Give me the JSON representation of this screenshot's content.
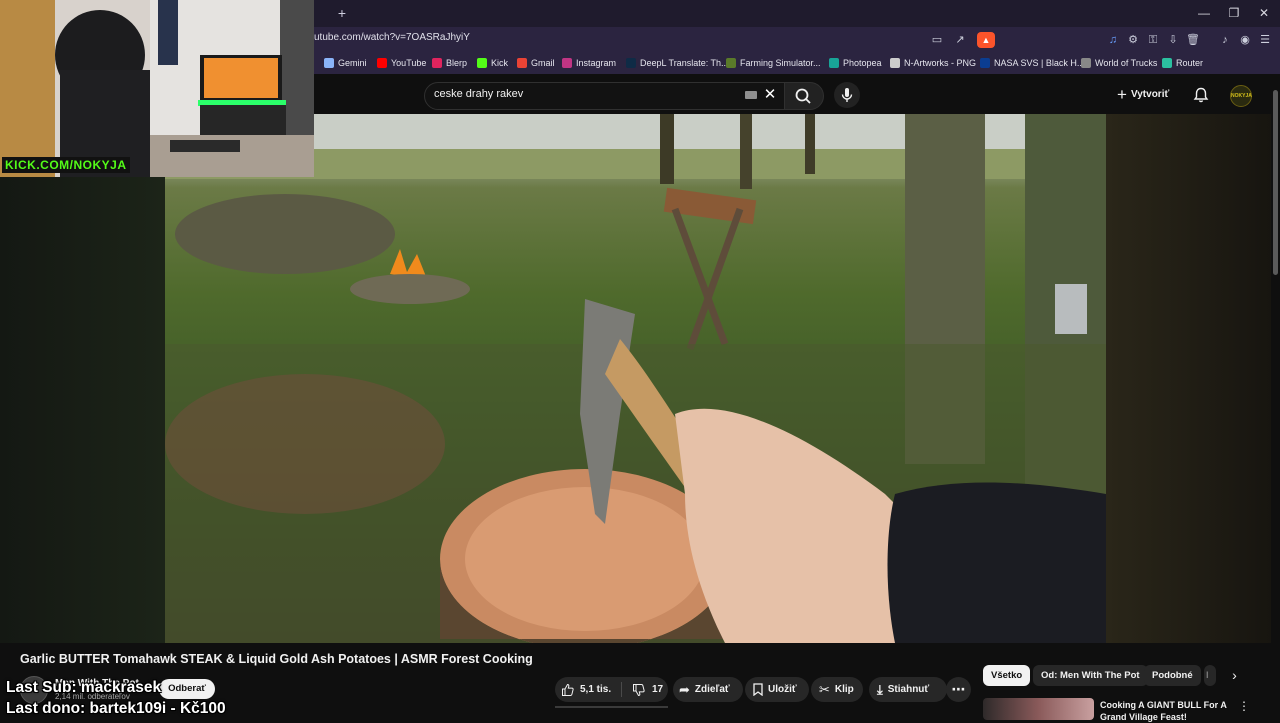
{
  "browser": {
    "url": "utube.com/watch?v=7OASRaJhyiY",
    "new_tab": "+",
    "window_controls": [
      "minimize-icon",
      "restore-icon",
      "close-icon"
    ],
    "bookmarks": [
      {
        "label": "Gemini",
        "icon": "gemini-icon",
        "color": "#8ab4f8"
      },
      {
        "label": "YouTube",
        "icon": "youtube-icon",
        "color": "#ff0000"
      },
      {
        "label": "Blerp",
        "icon": "blerp-icon",
        "color": "#e0245e"
      },
      {
        "label": "Kick",
        "icon": "kick-icon",
        "color": "#53fc18"
      },
      {
        "label": "Gmail",
        "icon": "gmail-icon",
        "color": "#ea4335"
      },
      {
        "label": "Instagram",
        "icon": "instagram-icon",
        "color": "#c13584"
      },
      {
        "label": "DeepL Translate: Th...",
        "icon": "deepl-icon",
        "color": "#0f2b46"
      },
      {
        "label": "Farming Simulator...",
        "icon": "farming-icon",
        "color": "#5a7a2a"
      },
      {
        "label": "Photopea",
        "icon": "photopea-icon",
        "color": "#18a497"
      },
      {
        "label": "N-Artworks - PNG",
        "icon": "nartworks-icon",
        "color": "#cccccc"
      },
      {
        "label": "NASA SVS | Black H...",
        "icon": "nasa-icon",
        "color": "#0b3d91"
      },
      {
        "label": "World of Trucks",
        "icon": "wot-icon",
        "color": "#888888"
      },
      {
        "label": "Router",
        "icon": "router-icon",
        "color": "#2bc0a0"
      }
    ]
  },
  "youtube": {
    "search_value": "ceske drahy rakev",
    "create_label": "Vytvoriť",
    "avatar_text": "NOKYJA",
    "video_title": "Garlic BUTTER Tomahawk STEAK & Liquid Gold Ash Potatoes | ASMR Forest Cooking",
    "channel_name": "Men With The Pot",
    "channel_subs": "2,14 mil. odberateľov",
    "subscribe_label": "Odberať",
    "likes": "5,1 tis.",
    "dislikes": "17",
    "share_label": "Zdieľať",
    "save_label": "Uložiť",
    "clip_label": "Klip",
    "download_label": "Stiahnuť",
    "chips": [
      "Všetko",
      "Od: Men With The Pot",
      "Podobné",
      "I"
    ],
    "rec_title": "Cooking A GIANT BULL For A Grand Village Feast!"
  },
  "stream": {
    "cam_tag": "KICK.COM/NOKYJA",
    "last_sub": "Last Sub: mackrasek",
    "last_dono": "Last dono: bartek109i - Kč100"
  },
  "colors": {
    "kick_green": "#53fc18",
    "youtube_bg": "#0f0f0f",
    "browser_chrome": "#2b2440"
  }
}
